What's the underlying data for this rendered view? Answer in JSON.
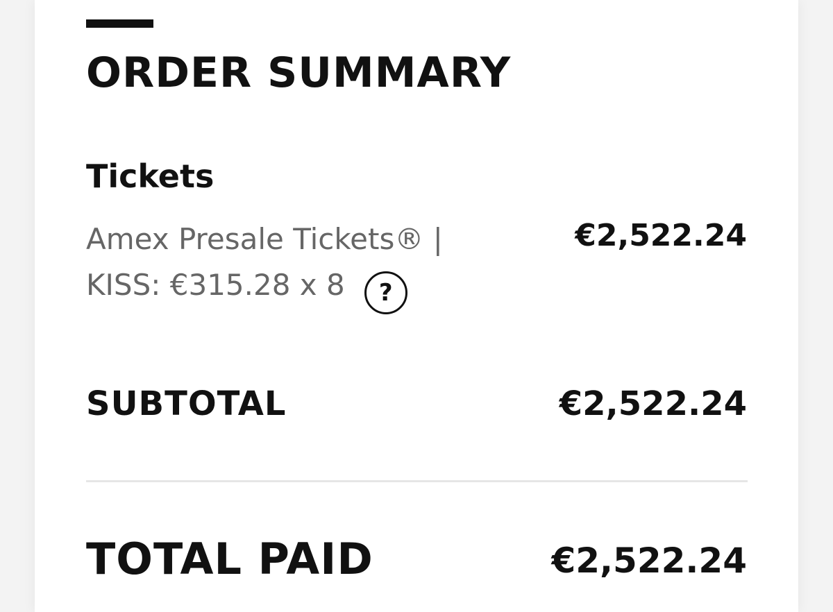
{
  "order_summary": {
    "title": "ORDER SUMMARY",
    "section_heading": "Tickets",
    "line_item": {
      "description_line1": "Amex Presale Tickets® |",
      "description_line2": "KISS: €315.28 x 8",
      "help_symbol": "?",
      "amount": "€2,522.24"
    },
    "subtotal": {
      "label": "SUBTOTAL",
      "amount": "€2,522.24"
    },
    "total": {
      "label": "TOTAL PAID",
      "amount": "€2,522.24"
    }
  },
  "icons": {
    "help": "question-circle-icon"
  },
  "colors": {
    "text_primary": "#111111",
    "text_secondary": "#666666",
    "divider": "#e6e6e6",
    "background": "#f3f3f3",
    "card": "#ffffff"
  }
}
